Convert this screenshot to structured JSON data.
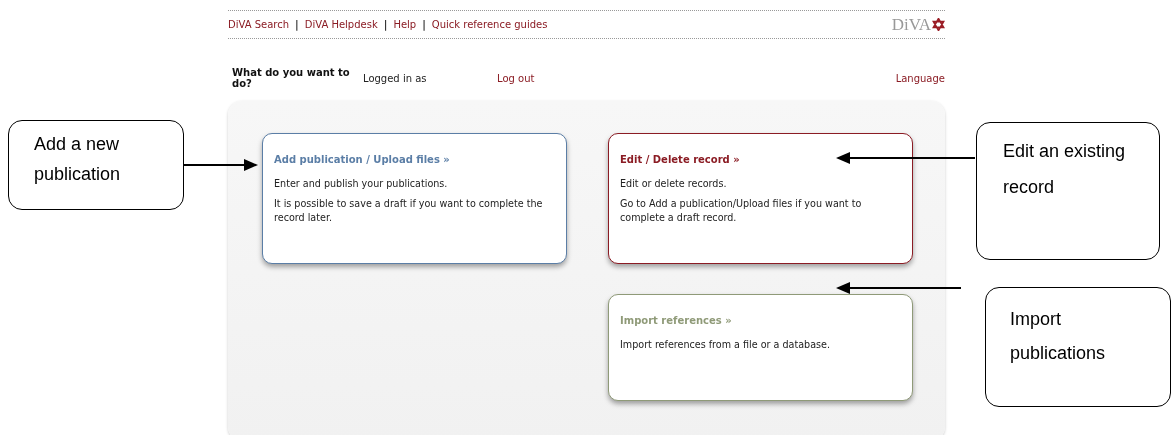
{
  "header": {
    "links": [
      {
        "label": "DiVA Search"
      },
      {
        "separator": "|",
        "label": "DiVA Helpdesk"
      },
      {
        "separator": "|",
        "label": "Help"
      },
      {
        "separator": "|",
        "label": "Quick reference guides"
      }
    ],
    "logo": "DiVA"
  },
  "toolbar": {
    "prompt": "What do you want to do?",
    "logged_in": "Logged in as",
    "logout": "Log out",
    "language": "Language"
  },
  "columns": [
    [
      {
        "title": "Add publication / Upload files »",
        "color": "#5b7ea6",
        "paragraphs": [
          "Enter and publish your publications.",
          "It is possible to save a draft if you want to complete the record later."
        ]
      }
    ],
    [
      {
        "title": "Edit / Delete record »",
        "color": "#8b1c24",
        "paragraphs": [
          "Edit or delete records.",
          "Go to Add a publication/Upload files if you want to complete a draft record."
        ]
      },
      {
        "title": "Import references »",
        "color": "#8f9a78",
        "paragraphs": [
          "Import references from a file or a database."
        ]
      }
    ]
  ],
  "callouts": [
    {
      "text": "Add a new publication"
    },
    {
      "text": "Edit an existing record"
    },
    {
      "text": "Import publications"
    }
  ]
}
